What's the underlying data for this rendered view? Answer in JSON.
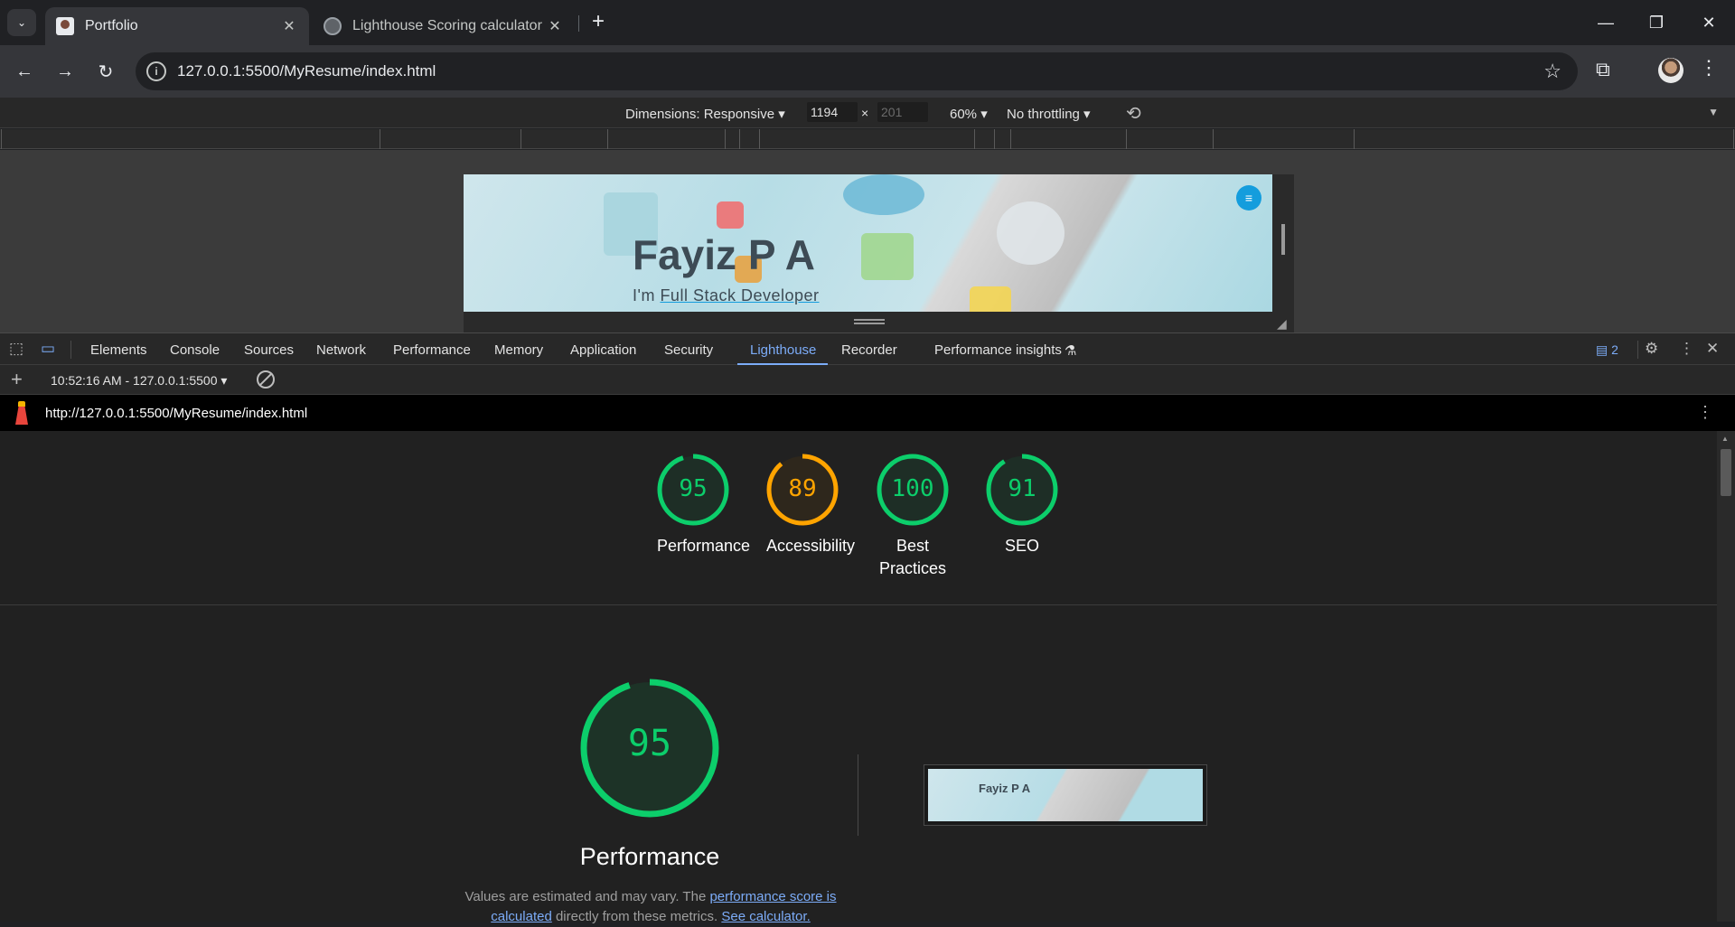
{
  "browser": {
    "tabs": [
      {
        "title": "Portfolio",
        "active": true
      },
      {
        "title": "Lighthouse Scoring calculator",
        "active": false
      }
    ],
    "url": "127.0.0.1:5500/MyResume/index.html"
  },
  "device_toolbar": {
    "dimensions_label": "Dimensions: Responsive ▾",
    "width": "1194",
    "times": "×",
    "height_placeholder": "201",
    "zoom": "60% ▾",
    "throttle": "No throttling ▾"
  },
  "site": {
    "name": "Fayiz P A",
    "subtitle_prefix": "I'm ",
    "subtitle_role": "Full Stack Developer",
    "menu_icon": "≡"
  },
  "devtools": {
    "tabs": [
      "Elements",
      "Console",
      "Sources",
      "Network",
      "Performance",
      "Memory",
      "Application",
      "Security",
      "Lighthouse",
      "Recorder",
      "Performance insights"
    ],
    "active_tab": "Lighthouse",
    "issues_count": "2",
    "report_selector": "10:52:16 AM - 127.0.0.1:5500 ▾"
  },
  "lighthouse": {
    "url": "http://127.0.0.1:5500/MyResume/index.html",
    "scores": [
      {
        "label": "Performance",
        "value": 95,
        "color": "#0cce6b"
      },
      {
        "label": "Accessibility",
        "value": 89,
        "color": "#ffa400"
      },
      {
        "label": "Best Practices",
        "value": 100,
        "color": "#0cce6b"
      },
      {
        "label": "SEO",
        "value": 91,
        "color": "#0cce6b"
      }
    ],
    "performance": {
      "score": "95",
      "title": "Performance",
      "note_start": "Values are estimated and may vary. The ",
      "note_link1": "performance score is calculated",
      "note_mid": " directly from these metrics. ",
      "note_link2": "See calculator."
    },
    "thumbnail_text": "Fayiz P A"
  }
}
